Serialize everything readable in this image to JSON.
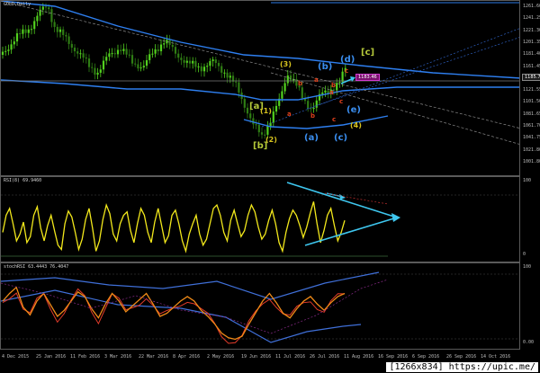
{
  "main": {
    "title": "GOLD,Daily",
    "price_label": "1183.46",
    "right_badge": "1185.7",
    "price_ticks": [
      "1261.60",
      "1241.25",
      "1221.30",
      "1201.35",
      "1181.40",
      "1161.45",
      "1141.50",
      "1121.55",
      "1101.50",
      "1081.65",
      "1061.70",
      "1041.75",
      "1021.80",
      "1001.80"
    ],
    "wave_labels": [
      {
        "t": "[c]",
        "c": "#b5c93a",
        "s": 10
      },
      {
        "t": "(d)",
        "c": "#3a8ef0",
        "s": 10
      },
      {
        "t": "(b)",
        "c": "#3a8ef0",
        "s": 10
      },
      {
        "t": "(3)",
        "c": "#d6c21e",
        "s": 8
      },
      {
        "t": "c",
        "c": "#e0401c",
        "s": 7
      },
      {
        "t": "a",
        "c": "#e0401c",
        "s": 7
      },
      {
        "t": "b",
        "c": "#e0401c",
        "s": 7
      },
      {
        "t": "b",
        "c": "#e0401c",
        "s": 7
      },
      {
        "t": "a",
        "c": "#e0401c",
        "s": 7
      },
      {
        "t": "c",
        "c": "#e0401c",
        "s": 7
      },
      {
        "t": "[a]",
        "c": "#b5c93a",
        "s": 10
      },
      {
        "t": "(1)",
        "c": "#d6c21e",
        "s": 8
      },
      {
        "t": "a",
        "c": "#e0401c",
        "s": 7
      },
      {
        "t": "b",
        "c": "#e0401c",
        "s": 7
      },
      {
        "t": "(e)",
        "c": "#3a8ef0",
        "s": 10
      },
      {
        "t": "c",
        "c": "#e0401c",
        "s": 7
      },
      {
        "t": "(4)",
        "c": "#d6c21e",
        "s": 8
      },
      {
        "t": "(a)",
        "c": "#3a8ef0",
        "s": 10
      },
      {
        "t": "(c)",
        "c": "#3a8ef0",
        "s": 10
      },
      {
        "t": "(2)",
        "c": "#d6c21e",
        "s": 8
      },
      {
        "t": "[b]",
        "c": "#b5c93a",
        "s": 10
      }
    ]
  },
  "rsi": {
    "title": "RSI(8) 69.9460",
    "ticks": [
      "100",
      "0"
    ]
  },
  "stoch": {
    "title": "stochRSI 63.4443 76.4047",
    "ticks": [
      "100",
      "0.00"
    ]
  },
  "dates": [
    "4 Dec 2015",
    "25 Jan 2016",
    "11 Feb 2016",
    "3 Mar 2016",
    "22 Mar 2016",
    "8 Apr 2016",
    "2 May 2016",
    "19 Jun 2016",
    "11 Jul 2016",
    "26 Jul 2016",
    "11 Aug 2016",
    "16 Sep 2016",
    "6 Sep 2016",
    "26 Sep 2016",
    "14 Oct 2016"
  ],
  "watermark": "[1266x834] https://upic.me/",
  "colors": {
    "up": "#52d11e",
    "down": "#2f7d14",
    "band": "#2e7ff0",
    "rsi": "#f2e81b",
    "arrow": "#3ec6ee",
    "stoch_k": "#f08a17",
    "stoch_d": "#e23b2a"
  }
}
